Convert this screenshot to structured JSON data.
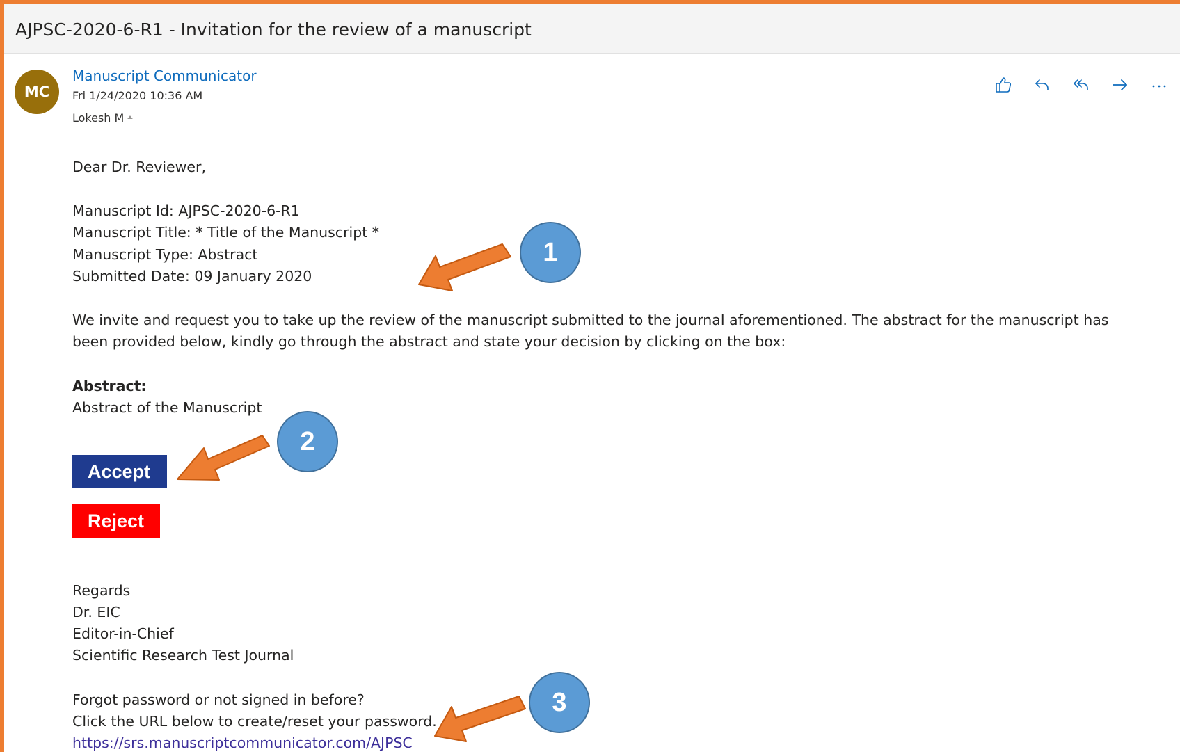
{
  "email": {
    "subject": "AJPSC-2020-6-R1 - Invitation for the review of a manuscript",
    "sender": {
      "initials": "MC",
      "name": "Manuscript Communicator",
      "avatar_color": "#986f0b"
    },
    "date": "Fri 1/24/2020 10:36 AM",
    "to": "Lokesh M",
    "actions": [
      "like-icon",
      "reply-icon",
      "reply-all-icon",
      "forward-icon",
      "more-icon"
    ],
    "body": {
      "greeting": "Dear Dr. Reviewer,",
      "manuscript_id": "Manuscript Id: AJPSC-2020-6-R1",
      "manuscript_title": "Manuscript Title: * Title of the Manuscript *",
      "manuscript_type": "Manuscript Type: Abstract",
      "submitted_date": "Submitted Date: 09 January 2020",
      "invite_line1": "We invite and request you to take up the review of the manuscript submitted to the journal aforementioned. The abstract for the manuscript has",
      "invite_line2": "been provided below, kindly go through the abstract and state your decision by clicking on the box:",
      "abstract_heading": "Abstract:",
      "abstract_text": "Abstract of the Manuscript",
      "accept_label": "Accept",
      "reject_label": "Reject",
      "regards": "Regards",
      "signer": "Dr. EIC",
      "signer_role": "Editor-in-Chief",
      "journal": "Scientific Research Test Journal",
      "forgot_line1": "Forgot password or not signed in before?",
      "forgot_line2": "Click the URL below to create/reset your password.",
      "url": "https://srs.manuscriptcommunicator.com/AJPSC"
    }
  },
  "annotations": {
    "callout_1": "1",
    "callout_2": "2",
    "callout_3": "3"
  },
  "colors": {
    "frame": "#ed7d31",
    "accept": "#1f3b8f",
    "reject": "#ff0000",
    "callout": "#5b9bd5",
    "arrow": "#ed7d31",
    "link": "#0f6cbd"
  }
}
